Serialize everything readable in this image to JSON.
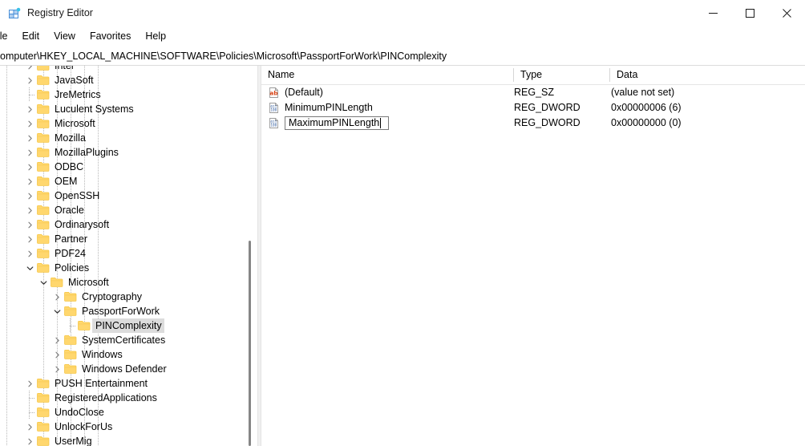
{
  "window": {
    "title": "Registry Editor",
    "icon": "registry-editor-icon",
    "controls": {
      "minimize": "minimize-icon",
      "maximize": "maximize-icon",
      "close": "close-icon"
    }
  },
  "menubar": {
    "items": [
      {
        "label": "ile"
      },
      {
        "label": "Edit"
      },
      {
        "label": "View"
      },
      {
        "label": "Favorites"
      },
      {
        "label": "Help"
      }
    ]
  },
  "address": {
    "path": "omputer\\HKEY_LOCAL_MACHINE\\SOFTWARE\\Policies\\Microsoft\\PassportForWork\\PINComplexity"
  },
  "tree": {
    "items": [
      {
        "label": "Intel",
        "level": 1,
        "state": "collapsed",
        "selected": false
      },
      {
        "label": "JavaSoft",
        "level": 1,
        "state": "collapsed",
        "selected": false
      },
      {
        "label": "JreMetrics",
        "level": 1,
        "state": "leaf",
        "selected": false
      },
      {
        "label": "Luculent Systems",
        "level": 1,
        "state": "collapsed",
        "selected": false
      },
      {
        "label": "Microsoft",
        "level": 1,
        "state": "collapsed",
        "selected": false
      },
      {
        "label": "Mozilla",
        "level": 1,
        "state": "collapsed",
        "selected": false
      },
      {
        "label": "MozillaPlugins",
        "level": 1,
        "state": "collapsed",
        "selected": false
      },
      {
        "label": "ODBC",
        "level": 1,
        "state": "collapsed",
        "selected": false
      },
      {
        "label": "OEM",
        "level": 1,
        "state": "collapsed",
        "selected": false
      },
      {
        "label": "OpenSSH",
        "level": 1,
        "state": "collapsed",
        "selected": false
      },
      {
        "label": "Oracle",
        "level": 1,
        "state": "collapsed",
        "selected": false
      },
      {
        "label": "Ordinarysoft",
        "level": 1,
        "state": "collapsed",
        "selected": false
      },
      {
        "label": "Partner",
        "level": 1,
        "state": "collapsed",
        "selected": false
      },
      {
        "label": "PDF24",
        "level": 1,
        "state": "collapsed",
        "selected": false
      },
      {
        "label": "Policies",
        "level": 1,
        "state": "expanded",
        "selected": false
      },
      {
        "label": "Microsoft",
        "level": 2,
        "state": "expanded",
        "selected": false
      },
      {
        "label": "Cryptography",
        "level": 3,
        "state": "collapsed",
        "selected": false
      },
      {
        "label": "PassportForWork",
        "level": 3,
        "state": "expanded",
        "selected": false
      },
      {
        "label": "PINComplexity",
        "level": 4,
        "state": "leaf",
        "selected": true
      },
      {
        "label": "SystemCertificates",
        "level": 3,
        "state": "collapsed",
        "selected": false
      },
      {
        "label": "Windows",
        "level": 3,
        "state": "collapsed",
        "selected": false
      },
      {
        "label": "Windows Defender",
        "level": 3,
        "state": "collapsed",
        "selected": false
      },
      {
        "label": "PUSH Entertainment",
        "level": 1,
        "state": "collapsed",
        "selected": false
      },
      {
        "label": "RegisteredApplications",
        "level": 1,
        "state": "leaf",
        "selected": false
      },
      {
        "label": "UndoClose",
        "level": 1,
        "state": "leaf",
        "selected": false
      },
      {
        "label": "UnlockForUs",
        "level": 1,
        "state": "collapsed",
        "selected": false
      },
      {
        "label": "UserMig",
        "level": 1,
        "state": "collapsed",
        "selected": false
      }
    ]
  },
  "values": {
    "columns": [
      {
        "key": "name",
        "label": "Name"
      },
      {
        "key": "type",
        "label": "Type"
      },
      {
        "key": "data",
        "label": "Data"
      }
    ],
    "rows": [
      {
        "icon": "string-value-icon",
        "name": "(Default)",
        "type": "REG_SZ",
        "data": "(value not set)",
        "editing": false
      },
      {
        "icon": "dword-value-icon",
        "name": "MinimumPINLength",
        "type": "REG_DWORD",
        "data": "0x00000006 (6)",
        "editing": false
      },
      {
        "icon": "dword-value-icon",
        "name": "MaximumPINLength",
        "type": "REG_DWORD",
        "data": "0x00000000 (0)",
        "editing": true
      }
    ]
  },
  "colors": {
    "folder": "#ffd76e",
    "folder_dark": "#f5c33c",
    "selection": "#dcdcdc",
    "accent": "#0078d7",
    "string_icon": "#d84315",
    "dword_icon": "#2f5a9e"
  }
}
